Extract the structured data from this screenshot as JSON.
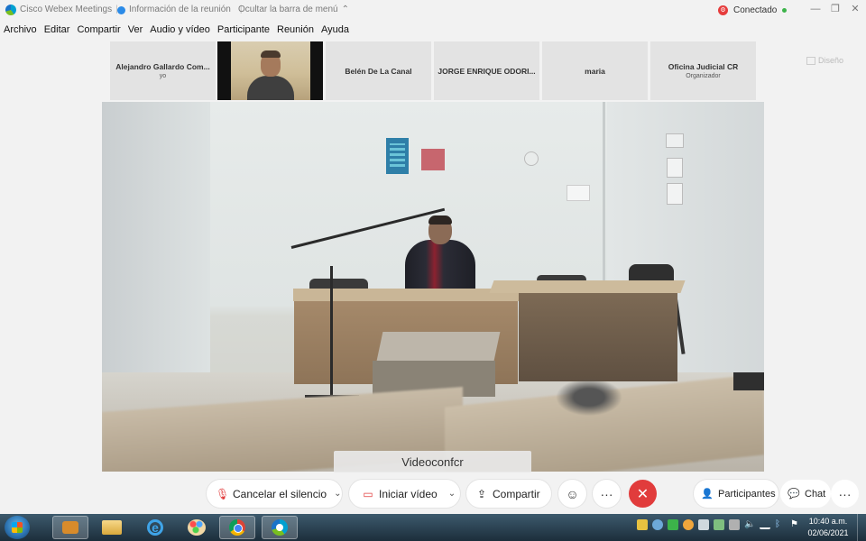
{
  "titlebar": {
    "app_name": "Cisco Webex Meetings",
    "meeting_info": "Información de la reunión",
    "hide_menu": "Ocultar la barra de menú",
    "connection_status": "Conectado",
    "hide_menu_chevron": "⌃",
    "minimize": "—",
    "restore": "❐",
    "close": "✕"
  },
  "menu": [
    "Archivo",
    "Editar",
    "Compartir",
    "Ver",
    "Audio y vídeo",
    "Participante",
    "Reunión",
    "Ayuda"
  ],
  "participants": [
    {
      "name": "Alejandro Gallardo Com...",
      "sub": "yo"
    },
    {
      "name": "",
      "sub": ""
    },
    {
      "name": "Belén De La Canal",
      "sub": ""
    },
    {
      "name": "JORGE ENRIQUE ODORI...",
      "sub": ""
    },
    {
      "name": "maria",
      "sub": ""
    },
    {
      "name": "Oficina Judicial CR",
      "sub": "Organizador"
    }
  ],
  "layout_button": "Diseño",
  "main_video": {
    "speaker_label": "Videoconfcr"
  },
  "controls": {
    "mute_label": "Cancelar el silencio",
    "video_label": "Iniciar vídeo",
    "share_label": "Compartir",
    "reactions_icon": "☺",
    "more_icon": "···",
    "end_icon": "✕",
    "participants_label": "Participantes",
    "chat_label": "Chat",
    "overflow_icon": "···"
  },
  "taskbar": {
    "time": "10:40 a.m.",
    "date": "02/06/2021",
    "apps": [
      "start-button",
      "media-player",
      "file-explorer",
      "internet-explorer",
      "paint",
      "chrome",
      "webex"
    ]
  },
  "colors": {
    "end_call": "#e13c3c",
    "connected_dot": "#3cb34a",
    "accent": "#2b8be8"
  }
}
